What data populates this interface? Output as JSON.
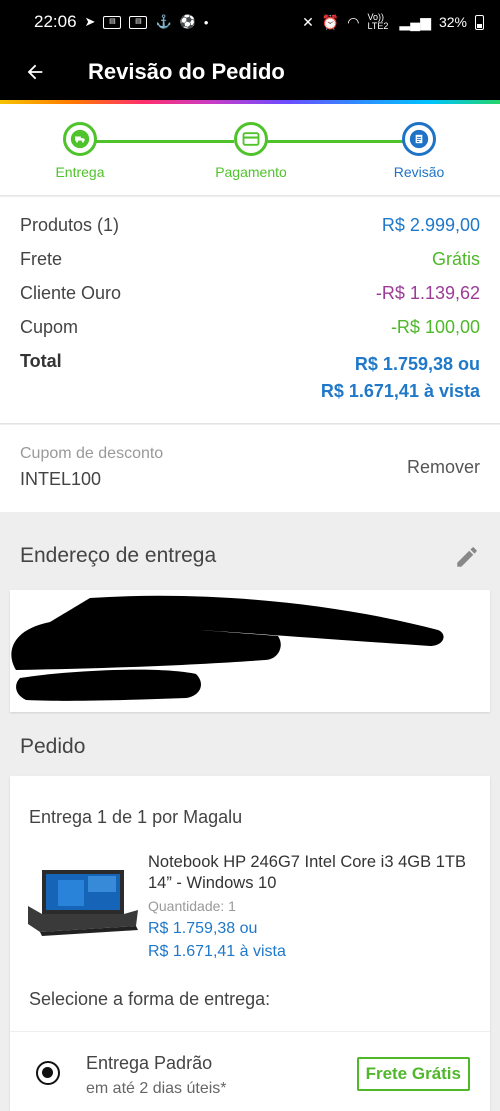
{
  "status_bar": {
    "time": "22:06",
    "network": "Vo)) LTE2",
    "battery": "32%"
  },
  "app_bar": {
    "title": "Revisão do Pedido"
  },
  "steps": [
    {
      "label": "Entrega",
      "icon": "truck-icon",
      "state": "done"
    },
    {
      "label": "Pagamento",
      "icon": "card-icon",
      "state": "done"
    },
    {
      "label": "Revisão",
      "icon": "document-icon",
      "state": "active"
    }
  ],
  "summary": {
    "rows": [
      {
        "label": "Produtos (1)",
        "value": "R$ 2.999,00",
        "color": "#1f78c8"
      },
      {
        "label": "Frete",
        "value": "Grátis",
        "color": "#4fb82a"
      },
      {
        "label": "Cliente Ouro",
        "value": "-R$ 1.139,62",
        "color": "#9c3c98"
      },
      {
        "label": "Cupom",
        "value": "-R$ 100,00",
        "color": "#4fb82a"
      }
    ],
    "total_label": "Total",
    "total_value": "R$ 1.759,38 ou",
    "total_cash": "R$ 1.671,41 à vista"
  },
  "coupon": {
    "label": "Cupom de desconto",
    "code": "INTEL100",
    "remove_label": "Remover"
  },
  "address": {
    "heading": "Endereço de entrega"
  },
  "order": {
    "heading": "Pedido",
    "delivery_title": "Entrega 1 de 1 por Magalu",
    "product": {
      "name": "Notebook HP 246G7 Intel Core i3 4GB 1TB 14” - Windows 10",
      "quantity": "Quantidade:  1",
      "price": "R$ 1.759,38 ou",
      "price_cash": "R$ 1.671,41 à vista"
    },
    "shipping_heading": "Selecione a forma de entrega:",
    "shipping_option": {
      "name": "Entrega Padrão",
      "time": "em até 2 dias úteis*",
      "badge": "Frete Grátis"
    }
  },
  "colors": {
    "accent_green": "#4fc32b",
    "accent_blue": "#1f73c6",
    "price_blue": "#1f78c8"
  }
}
